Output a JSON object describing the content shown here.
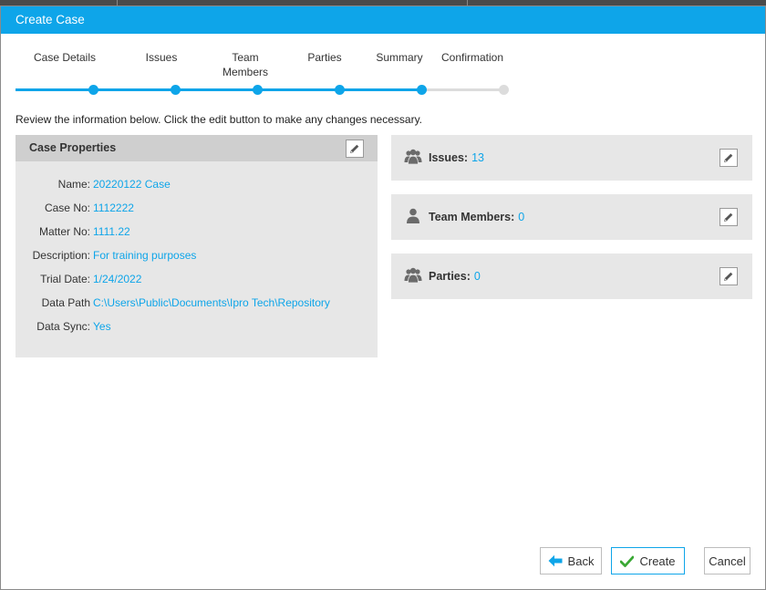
{
  "window": {
    "title": "Create Case"
  },
  "stepper": {
    "steps": [
      {
        "label": "Case Details",
        "state": "done"
      },
      {
        "label": "Issues",
        "state": "done"
      },
      {
        "label": "Team Members",
        "state": "done"
      },
      {
        "label": "Parties",
        "state": "done"
      },
      {
        "label": "Summary",
        "state": "current"
      },
      {
        "label": "Confirmation",
        "state": "todo"
      }
    ]
  },
  "instruction": "Review the information below. Click the edit button to make any changes necessary.",
  "case_properties": {
    "title": "Case Properties",
    "fields": [
      {
        "label": "Name:",
        "value": "20220122 Case"
      },
      {
        "label": "Case No:",
        "value": "1112222"
      },
      {
        "label": "Matter No:",
        "value": "1111.22"
      },
      {
        "label": "Description:",
        "value": "For training purposes"
      },
      {
        "label": "Trial Date:",
        "value": "1/24/2022"
      },
      {
        "label": "Data Path",
        "value": "C:\\Users\\Public\\Documents\\Ipro Tech\\Repository"
      },
      {
        "label": "Data Sync:",
        "value": "Yes"
      }
    ]
  },
  "summary_cards": [
    {
      "label": "Issues:",
      "count": "13",
      "icon": "group-icon"
    },
    {
      "label": "Team Members:",
      "count": "0",
      "icon": "person-icon"
    },
    {
      "label": "Parties:",
      "count": "0",
      "icon": "group-icon"
    }
  ],
  "buttons": {
    "back": "Back",
    "create": "Create",
    "cancel": "Cancel"
  },
  "colors": {
    "accent": "#0ea5e9",
    "panel": "#e7e7e7",
    "panel_header": "#cfcfcf",
    "check": "#3aa835"
  }
}
